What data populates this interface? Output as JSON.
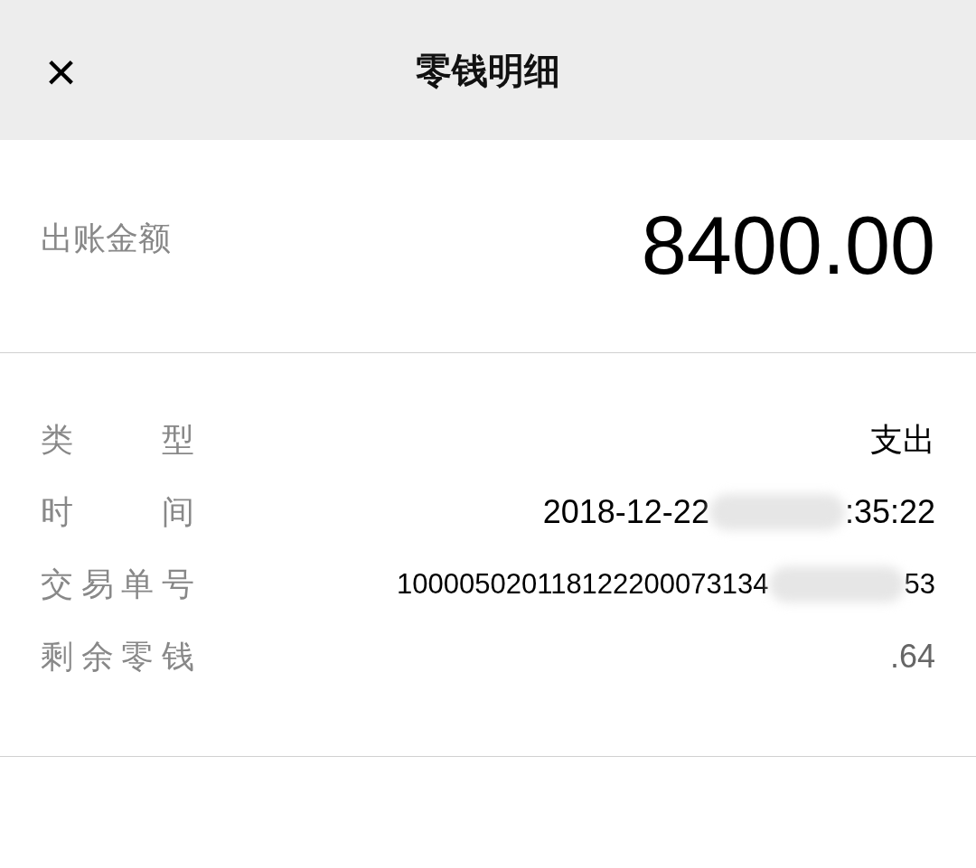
{
  "header": {
    "close_icon": "×",
    "title": "零钱明细"
  },
  "amount": {
    "label": "出账金额",
    "value": "8400.00"
  },
  "details": [
    {
      "label": "类型",
      "parts": [
        "支出"
      ],
      "kind": "text"
    },
    {
      "label": "时间",
      "parts": [
        "2018-12-22",
        ":35:22"
      ],
      "kind": "text"
    },
    {
      "label": "交易单号",
      "parts": [
        "100005020118122200073134",
        "53"
      ],
      "kind": "small"
    },
    {
      "label": "剩余零钱",
      "parts": [
        ".64"
      ],
      "kind": "faded"
    }
  ]
}
